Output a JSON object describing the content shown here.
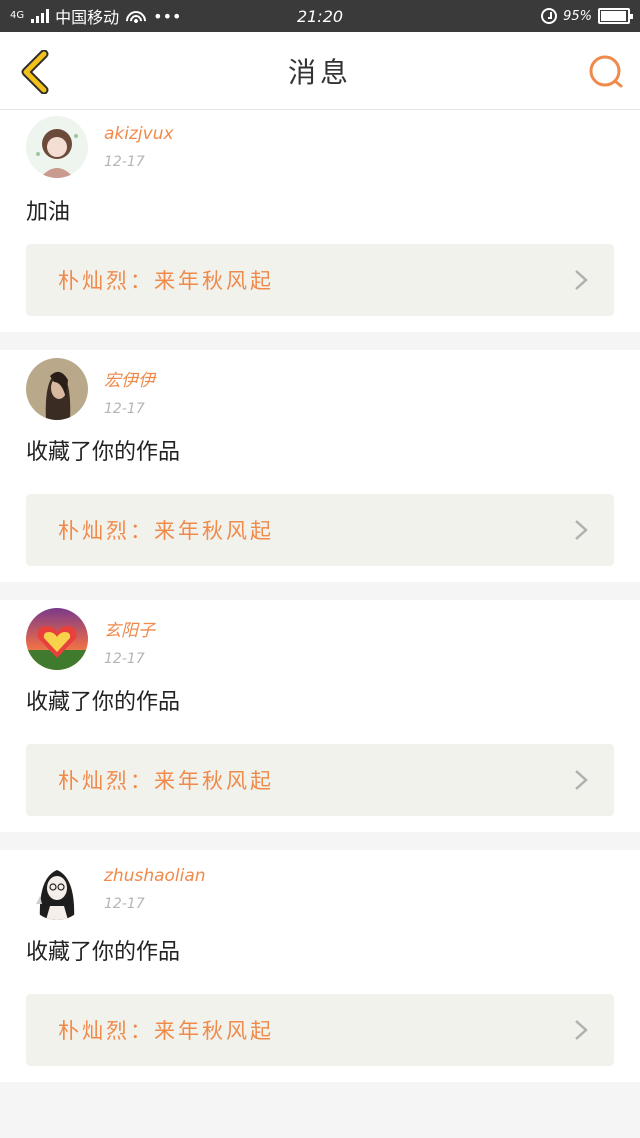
{
  "status_bar": {
    "network": "4G",
    "carrier": "中国移动",
    "overflow": "•••",
    "time": "21:20",
    "battery": "95%",
    "battery_level": 0.95
  },
  "nav": {
    "title": "消息",
    "back_icon": "chevron-left-icon",
    "search_icon": "search-icon"
  },
  "colors": {
    "accent": "#f08a4b",
    "back_accent": "#f2c21a",
    "card_link_bg": "#f2f2ec"
  },
  "messages": [
    {
      "username": "akizjvux",
      "time": "12-17",
      "text": "加油",
      "work": "朴灿烈：来年秋风起"
    },
    {
      "username": "宏伊伊",
      "time": "12-17",
      "text": "收藏了你的作品",
      "work": "朴灿烈：来年秋风起"
    },
    {
      "username": "玄阳子",
      "time": "12-17",
      "text": "收藏了你的作品",
      "work": "朴灿烈：来年秋风起"
    },
    {
      "username": "zhushaolian",
      "time": "12-17",
      "text": "收藏了你的作品",
      "work": "朴灿烈：来年秋风起"
    }
  ]
}
